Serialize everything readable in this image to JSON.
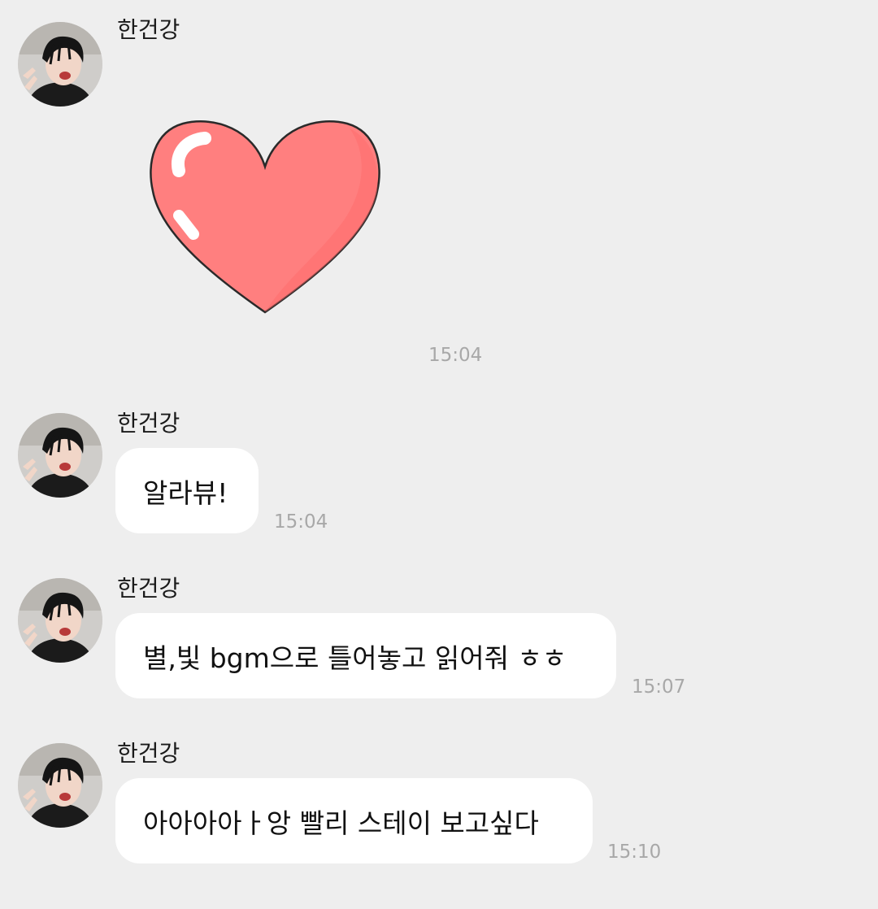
{
  "messages": [
    {
      "sender": "한건강",
      "type": "sticker",
      "sticker": "heart-sticker",
      "time": "15:04"
    },
    {
      "sender": "한건강",
      "type": "text",
      "text": "알라뷰!",
      "time": "15:04"
    },
    {
      "sender": "한건강",
      "type": "text",
      "text": "별,빛 bgm으로 틀어놓고 읽어줘 ㅎㅎ",
      "time": "15:07"
    },
    {
      "sender": "한건강",
      "type": "text",
      "text": "아아아아ㅏ앙 빨리 스테이 보고싶다",
      "time": "15:10"
    }
  ],
  "colors": {
    "background": "#eeeeee",
    "bubble": "#ffffff",
    "timestamp": "#a8a8a8",
    "heart": "#ff7f7f"
  }
}
